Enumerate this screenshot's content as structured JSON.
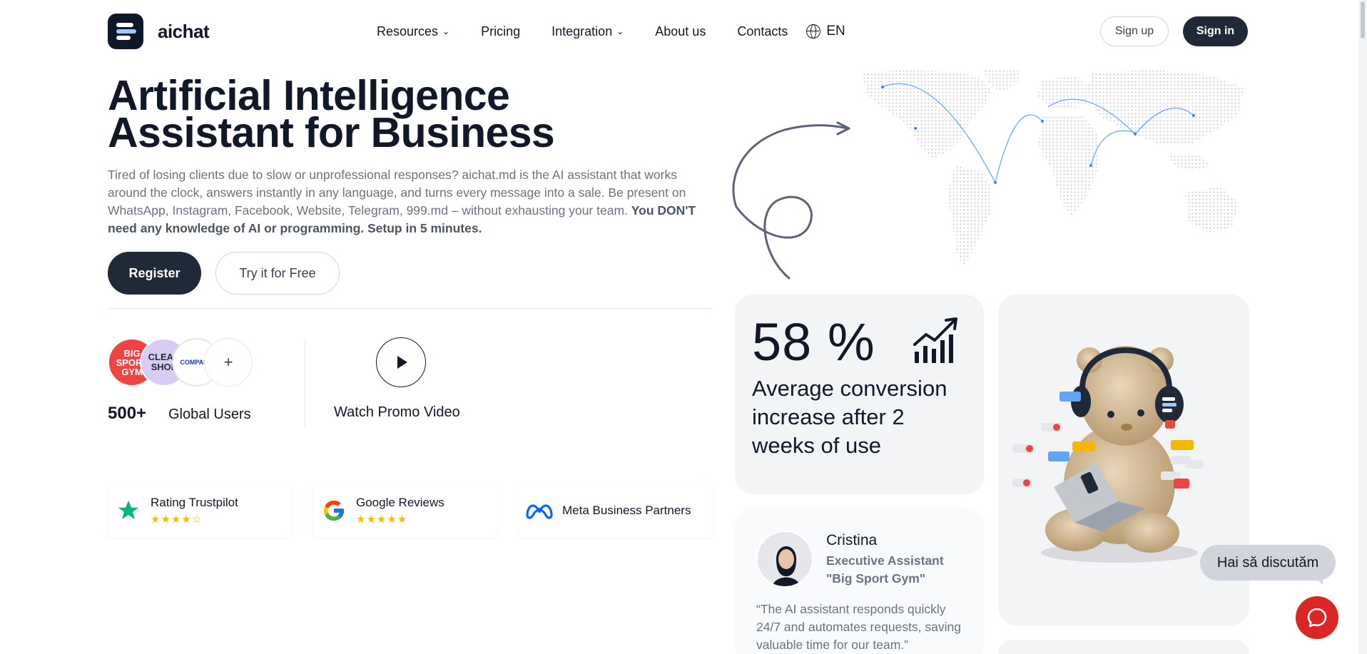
{
  "brand": {
    "name": "aichat"
  },
  "nav": {
    "items": [
      {
        "label": "Resources",
        "has_dropdown": true
      },
      {
        "label": "Pricing",
        "has_dropdown": false
      },
      {
        "label": "Integration",
        "has_dropdown": true
      },
      {
        "label": "About us",
        "has_dropdown": false
      },
      {
        "label": "Contacts",
        "has_dropdown": false
      }
    ],
    "language": "EN"
  },
  "auth": {
    "signup_label": "Sign up",
    "signin_label": "Sign in"
  },
  "hero": {
    "title_line1": "Artificial Intelligence",
    "title_line2": "Assistant for Business",
    "description": "Tired of losing clients due to slow or unprofessional responses? aichat.md is the AI assistant that works around the clock, answers instantly in any language, and turns every message into a sale. Be present on WhatsApp, Instagram, Facebook, Website, Telegram, 999.md – without exhausting your team. ",
    "description_bold": "You DON'T need any knowledge of AI or programming. Setup in 5 minutes.",
    "register_label": "Register",
    "try_label": "Try it for Free"
  },
  "social_proof": {
    "avatars": [
      {
        "text": "BIG SPORT GYM"
      },
      {
        "text": "CLEAN SHOE"
      },
      {
        "text": "COMPANY"
      },
      {
        "text": "+"
      }
    ],
    "count": "500+",
    "count_label": "Global Users",
    "promo_label": "Watch Promo Video"
  },
  "ratings": [
    {
      "title": "Rating Trustpilot",
      "stars": "★★★★☆",
      "icon": "trustpilot-star-icon"
    },
    {
      "title": "Google Reviews",
      "stars": "★★★★★",
      "icon": "google-icon"
    },
    {
      "title": "Meta Business Partners",
      "stars": "",
      "icon": "meta-icon"
    }
  ],
  "stat": {
    "value": "58 %",
    "text": "Average conversion increase after 2 weeks of use"
  },
  "testimonial": {
    "name": "Cristina",
    "role": "Executive Assistant \"Big Sport Gym\"",
    "quote": "“The AI assistant responds quickly 24/7 and automates requests, saving valuable time for our team.”"
  },
  "chat": {
    "bubble_text": "Hai să discutăm"
  },
  "colors": {
    "primary_dark": "#1f2937",
    "accent_red": "#dc2626",
    "star_gold": "#f5b800",
    "map_line": "#3b82f6"
  }
}
